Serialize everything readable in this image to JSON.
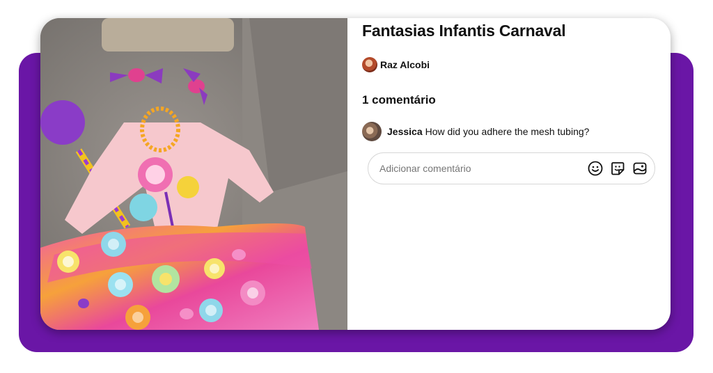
{
  "pin": {
    "title": "Fantasias Infantis Carnaval",
    "image": {
      "description_icon": "photo"
    }
  },
  "author": {
    "name": "Raz Alcobi"
  },
  "comments": {
    "heading": "1 comentário",
    "items": [
      {
        "user": "Jessica",
        "text": "How did you adhere the mesh tubing?"
      }
    ],
    "input": {
      "placeholder": "Adicionar comentário",
      "value": ""
    },
    "actions": [
      {
        "icon": "emoji-icon"
      },
      {
        "icon": "sticker-icon"
      },
      {
        "icon": "image-icon"
      }
    ]
  },
  "colors": {
    "frame": "#6a16a6",
    "card": "#ffffff",
    "text": "#111111",
    "muted": "#767676"
  }
}
